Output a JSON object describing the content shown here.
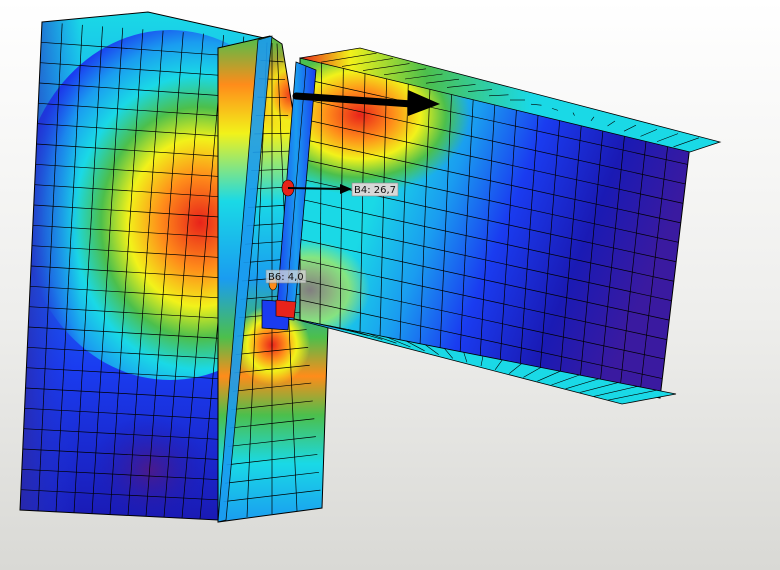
{
  "view": {
    "kind": "FEA stress contour of steel beam-to-column connection",
    "background": "#f4f4f2",
    "mesh_color": "#000000"
  },
  "colors": {
    "red": "#e8231a",
    "orange": "#ff8c1a",
    "yellow": "#f2f21a",
    "green": "#4cbf4c",
    "cyan": "#1ad9e6",
    "light-blue": "#1a9cf0",
    "blue": "#1a3cf0",
    "dark-blue": "#1a1ab4",
    "purple": "#4a1a8c"
  },
  "forces": [
    {
      "id": "flange-force",
      "label": ""
    },
    {
      "id": "bolt-b4",
      "label": "B4: 26,7"
    },
    {
      "id": "bolt-b6",
      "label": "B6: 4,0"
    }
  ]
}
